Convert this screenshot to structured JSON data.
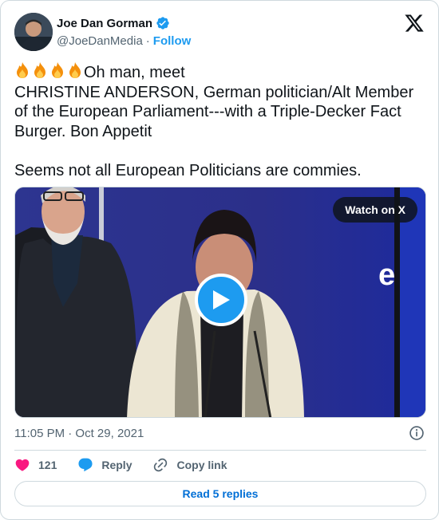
{
  "author": {
    "display_name": "Joe Dan Gorman",
    "handle": "@JoeDanMedia",
    "separator": "·",
    "follow_label": "Follow"
  },
  "tweet": {
    "lead_emoji": "🔥🔥🔥🔥",
    "line1": "Oh man, meet",
    "line2": "CHRISTINE ANDERSON, German politician/Alt Member of the European Parliament---with a Triple-Decker Fact Burger.  Bon Appetit",
    "line3": "Seems not all European Politicians are commies."
  },
  "media": {
    "watch_label": "Watch on X",
    "logo_glyph": "e"
  },
  "meta": {
    "timestamp": "11:05 PM · Oct 29, 2021"
  },
  "actions": {
    "like_count": "121",
    "reply_label": "Reply",
    "copy_label": "Copy link"
  },
  "replies_button": "Read 5 replies",
  "colors": {
    "accent": "#1d9bf0",
    "link_text": "#006fd6",
    "like": "#f91880",
    "muted": "#536471"
  },
  "icons": [
    "verified-badge-icon",
    "x-logo-icon",
    "fire-icon",
    "play-icon",
    "info-icon",
    "heart-icon",
    "reply-bubble-icon",
    "link-icon"
  ]
}
